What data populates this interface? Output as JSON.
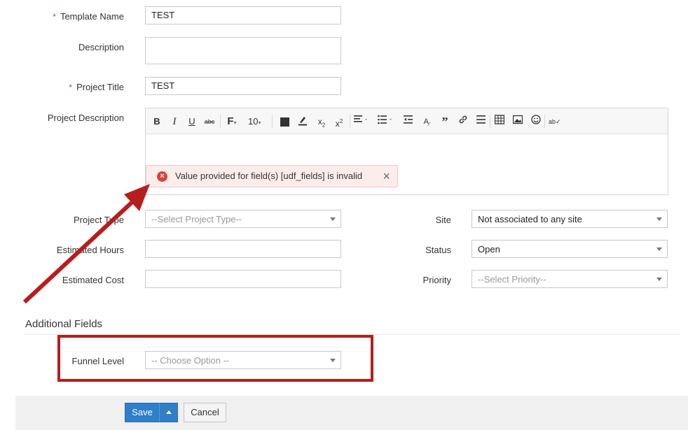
{
  "form": {
    "template_name": {
      "label": "Template Name",
      "value": "TEST",
      "required_mark": "*"
    },
    "description": {
      "label": "Description",
      "value": ""
    },
    "project_title": {
      "label": "Project Title",
      "value": "TEST",
      "required_mark": "*"
    },
    "project_description": {
      "label": "Project Description",
      "toolbar": {
        "bold": "B",
        "italic": "I",
        "underline": "U",
        "strike": "abc",
        "font": "F",
        "font_size": "10"
      }
    },
    "project_type": {
      "label": "Project Type",
      "placeholder": "--Select Project Type--"
    },
    "estimated_hours": {
      "label": "Estimated Hours",
      "value": ""
    },
    "estimated_cost": {
      "label": "Estimated Cost",
      "value": ""
    },
    "site": {
      "label": "Site",
      "value": "Not associated to any site"
    },
    "status": {
      "label": "Status",
      "value": "Open"
    },
    "priority": {
      "label": "Priority",
      "placeholder": "--Select Priority--"
    }
  },
  "error": {
    "message": "Value provided for field(s) [udf_fields] is invalid",
    "icon": "error-x-icon",
    "color": "#d9443b"
  },
  "additional_fields": {
    "title": "Additional Fields",
    "funnel_level": {
      "label": "Funnel Level",
      "placeholder": "-- Choose Option --"
    }
  },
  "actions": {
    "save": "Save",
    "cancel": "Cancel"
  },
  "colors": {
    "accent": "#2f7fc9",
    "annotation": "#b81d1d",
    "required": "#d9363e"
  }
}
